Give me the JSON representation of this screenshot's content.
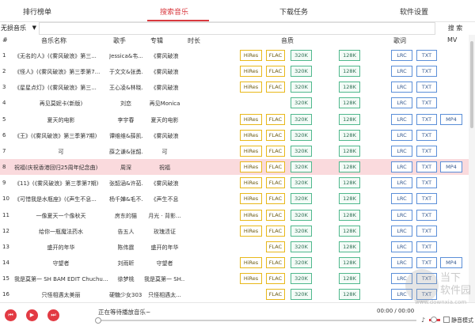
{
  "tabs": [
    "排行榜单",
    "搜索音乐",
    "下载任务",
    "软件设置"
  ],
  "toolbar": {
    "source": "无损音乐",
    "search_value": "",
    "search_button": "搜 索"
  },
  "columns": {
    "num": "#",
    "title": "音乐名称",
    "artist": "歌手",
    "album": "专辑",
    "duration": "时长",
    "quality": "音质",
    "lyrics": "歌词",
    "mv": "MV"
  },
  "rows": [
    {
      "num": "1",
      "title": "《无名的人》(《雾风破浪》第三...",
      "artist": "Jessica&韦...",
      "album": "《雾风破浪",
      "hires": true,
      "flac": true,
      "k320": true,
      "mp4": false,
      "hl": false,
      "center": false
    },
    {
      "num": "2",
      "title": "《怪人》(《雾风破浪》第三季第7...",
      "artist": "于文文&张勇...",
      "album": "《雾风破浪",
      "hires": true,
      "flac": true,
      "k320": true,
      "mp4": false,
      "hl": false,
      "center": false
    },
    {
      "num": "3",
      "title": "《星星点灯》(《雾风破浪》第三...",
      "artist": "王心凌&林晓...",
      "album": "《雾风破浪",
      "hires": true,
      "flac": true,
      "k320": true,
      "mp4": false,
      "hl": false,
      "center": false
    },
    {
      "num": "4",
      "title": "再见莫妮卡(新版)",
      "artist": "刘恋",
      "album": "再见Monica",
      "hires": false,
      "flac": false,
      "k320": true,
      "mp4": false,
      "hl": false,
      "center": true
    },
    {
      "num": "5",
      "title": "夏天的电影",
      "artist": "李宇春",
      "album": "夏天的电影",
      "hires": true,
      "flac": true,
      "k320": true,
      "mp4": true,
      "hl": false,
      "center": true
    },
    {
      "num": "6",
      "title": "《王》(《雾风破浪》第三季第7期)",
      "artist": "谭维维&薛凯...",
      "album": "《雾风破浪",
      "hires": true,
      "flac": true,
      "k320": true,
      "mp4": false,
      "hl": false,
      "center": false
    },
    {
      "num": "7",
      "title": "可",
      "artist": "薛之谦&张韶...",
      "album": "可",
      "hires": true,
      "flac": true,
      "k320": true,
      "mp4": false,
      "hl": false,
      "center": true
    },
    {
      "num": "8",
      "title": "祝福(庆祝香港回归25周年纪念曲)",
      "artist": "周深",
      "album": "祝福",
      "hires": true,
      "flac": true,
      "k320": true,
      "mp4": true,
      "hl": true,
      "center": false
    },
    {
      "num": "9",
      "title": "《11》(《雾风破浪》第三季第7期)",
      "artist": "张韶涵&许茹...",
      "album": "《雾风破浪",
      "hires": true,
      "flac": true,
      "k320": true,
      "mp4": false,
      "hl": false,
      "center": false
    },
    {
      "num": "10",
      "title": "《可惜我是水瓶座》(《声生不息...",
      "artist": "杨千嬅&毛不...",
      "album": "《声生不息",
      "hires": true,
      "flac": true,
      "k320": true,
      "mp4": false,
      "hl": false,
      "center": false
    },
    {
      "num": "11",
      "title": "一像夏天一个像秋天",
      "artist": "房东的猫",
      "album": "月光 · 背影...",
      "hires": true,
      "flac": true,
      "k320": true,
      "mp4": false,
      "hl": false,
      "center": true
    },
    {
      "num": "12",
      "title": "给你一瓶魔法药水",
      "artist": "告五人",
      "album": "玫瑰渍证",
      "hires": true,
      "flac": true,
      "k320": true,
      "mp4": false,
      "hl": false,
      "center": true
    },
    {
      "num": "13",
      "title": "盛开的年华",
      "artist": "陈伟霆",
      "album": "盛开的年华",
      "hires": false,
      "flac": true,
      "k320": true,
      "mp4": false,
      "hl": false,
      "center": true
    },
    {
      "num": "14",
      "title": "守望者",
      "artist": "刘雨昕",
      "album": "守望者",
      "hires": true,
      "flac": true,
      "k320": true,
      "mp4": true,
      "hl": false,
      "center": true
    },
    {
      "num": "15",
      "title": "我是莫第一 SH BAM EDIT Chuchu...",
      "artist": "徐梦桃",
      "album": "我是莫第一 SH...",
      "hires": true,
      "flac": true,
      "k320": true,
      "mp4": false,
      "hl": false,
      "center": false
    },
    {
      "num": "16",
      "title": "只怪相遇太美丽",
      "artist": "硬糖少女303...",
      "album": "只怪相遇太...",
      "hires": false,
      "flac": true,
      "k320": true,
      "mp4": false,
      "hl": false,
      "center": true
    }
  ],
  "labels": {
    "hires": "HiRes",
    "flac": "FLAC",
    "k320": "320K",
    "k128": "128K",
    "lrc": "LRC",
    "txt": "TXT",
    "mp4": "MP4"
  },
  "player": {
    "now_playing": "正在等待播放音乐~",
    "time": "00:00 / 00:00",
    "mute_label": "静音模式"
  },
  "watermark": {
    "text_1": "当下",
    "text_2": "软件园",
    "url": "www.downxia.com"
  },
  "colors": {
    "accent": "#d9393f",
    "highlight_row": "#fadadd",
    "gold": "#e8b81a",
    "green": "#50b88d",
    "blue": "#5b8fd8"
  }
}
